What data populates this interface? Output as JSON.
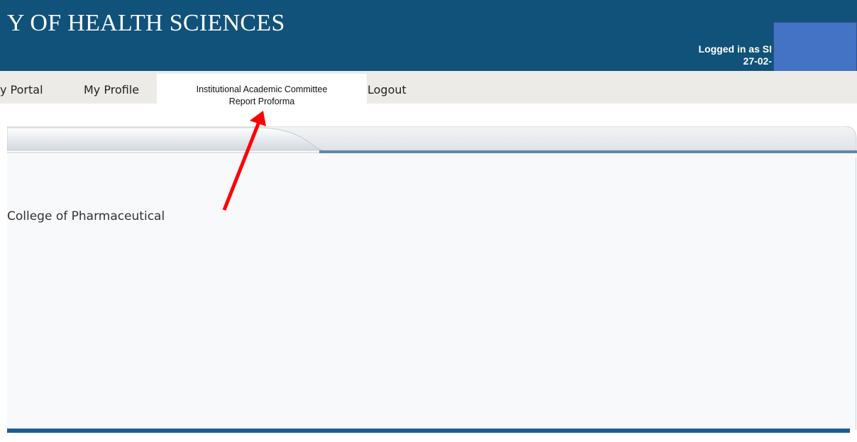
{
  "header": {
    "title": "Y OF HEALTH SCIENCES",
    "logged_in": "Logged in as SI",
    "date": "27-02-"
  },
  "menu": {
    "portal": "y Portal",
    "profile": "My Profile",
    "active_line1": "Institutional Academic Committee",
    "active_line2": "Report Proforma",
    "logout": "Logout"
  },
  "content": {
    "text": "College of Pharmaceutical"
  },
  "colors": {
    "header_bg": "#11527a",
    "redaction": "#4472c4",
    "arrow": "#ff0000"
  }
}
